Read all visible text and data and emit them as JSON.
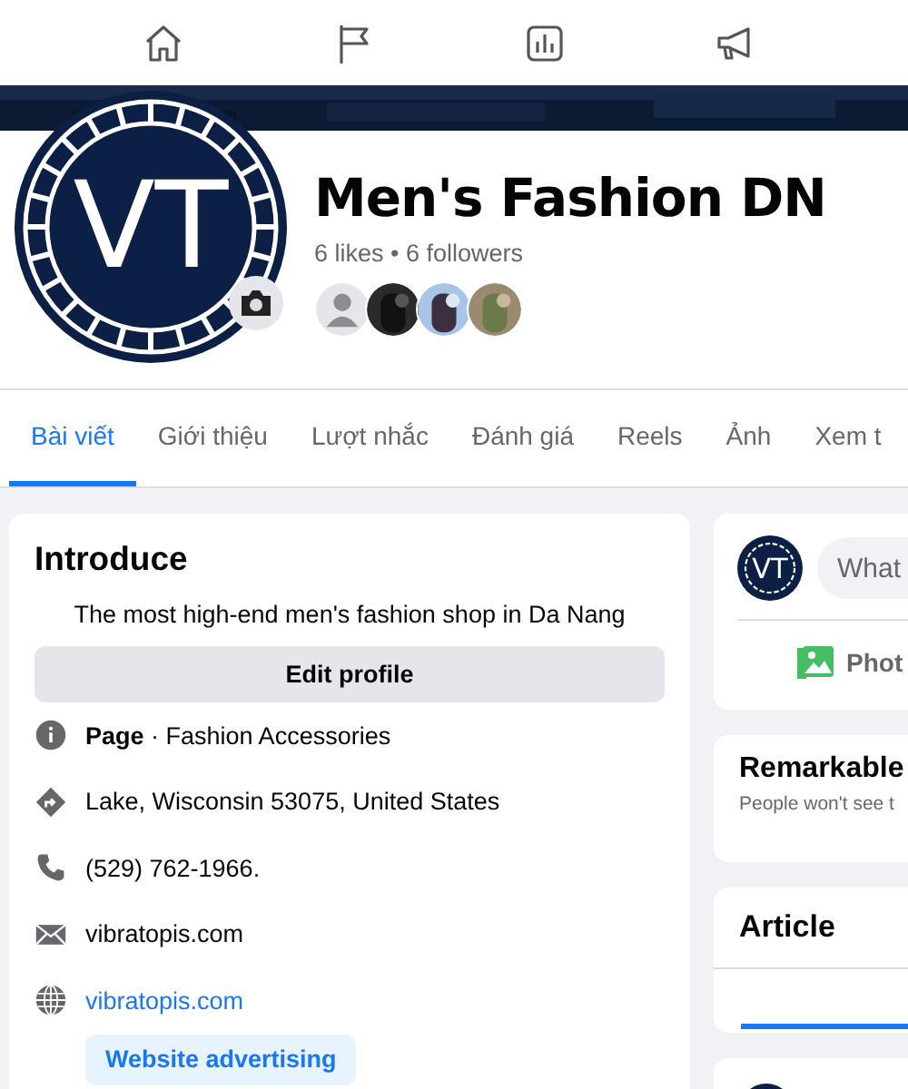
{
  "top_nav": [
    {
      "kind": "home",
      "selected": false
    },
    {
      "kind": "flag",
      "selected": false
    },
    {
      "kind": "chart",
      "selected": false
    },
    {
      "kind": "megaphone",
      "selected": false
    }
  ],
  "profile": {
    "logo_text": "VT",
    "name": "Men's Fashion DN",
    "stats": "6 likes • 6 followers",
    "follower_avatars": [
      {
        "kind": "silhouette"
      },
      {
        "kind": "picture"
      },
      {
        "kind": "picture"
      },
      {
        "kind": "picture"
      }
    ]
  },
  "tabs": [
    {
      "label": "Bài viết",
      "selected": true
    },
    {
      "label": "Giới thiệu",
      "selected": false
    },
    {
      "label": "Lượt nhắc",
      "selected": false
    },
    {
      "label": "Đánh giá",
      "selected": false
    },
    {
      "label": "Reels",
      "selected": false
    },
    {
      "label": "Ảnh",
      "selected": false
    },
    {
      "label": "Xem t",
      "selected": false
    }
  ],
  "introduce": {
    "title": "Introduce",
    "description": "The most high-end men's fashion shop in Da Nang",
    "edit_button": "Edit profile",
    "items": [
      {
        "kind": "info",
        "text": "**Page** · Fashion Accessories"
      },
      {
        "kind": "location",
        "text": "Lake, Wisconsin 53075, United States"
      },
      {
        "kind": "phone",
        "text": "(529) 762-1966."
      },
      {
        "kind": "email",
        "text": "vibratopis.com"
      },
      {
        "kind": "website",
        "text": "vibratopis.com"
      }
    ],
    "ad_button": "Website advertising"
  },
  "composer": {
    "logo_text": "VT",
    "placeholder": "What",
    "photo_label": "Phot"
  },
  "remarkable": {
    "title": "Remarkable",
    "subtitle": "People won't see t"
  },
  "article": {
    "title": "Article"
  }
}
